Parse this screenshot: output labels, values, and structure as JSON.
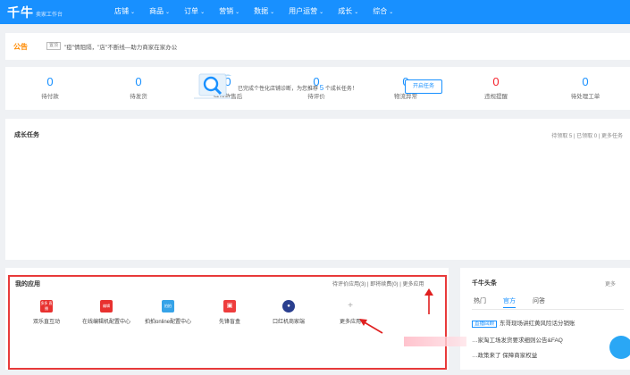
{
  "header": {
    "logo": "千牛",
    "subtitle": "卖家工作台",
    "nav": [
      "店铺",
      "商品",
      "订单",
      "营销",
      "数据",
      "用户运营",
      "成长",
      "综合"
    ]
  },
  "notice": {
    "label": "公告",
    "tag": "置顶",
    "text": "\"疫\"情阻隔，\"店\"不断线—助力商家在家办公"
  },
  "stats": [
    {
      "value": "0",
      "label": "待付款"
    },
    {
      "value": "0",
      "label": "待发货"
    },
    {
      "value": "0",
      "label": "待退款售后"
    },
    {
      "value": "0",
      "label": "待评价"
    },
    {
      "value": "0",
      "label": "物流异常"
    },
    {
      "value": "0",
      "label": "违规提醒"
    },
    {
      "value": "0",
      "label": "待处理工单"
    }
  ],
  "colors": {
    "primary": "#1890ff",
    "alert": "#f5222d",
    "highlight_border": "#e83a3a",
    "notice": "#ff8a00"
  },
  "growth": {
    "title": "成长任务",
    "summary": "待领取 5 | 已领取 0 | 更多任务",
    "message_prefix": "已完成个性化店铺诊断，为您推荐",
    "message_count": "5",
    "message_suffix": "个成长任务！",
    "button": "开启任务"
  },
  "apps": {
    "title": "我的应用",
    "links": "待评价应用(3) | 即将续费(0) | 更多应用",
    "items": [
      {
        "label": "双乐直互动",
        "icon": "red-app-icon",
        "color": "#e8312f",
        "glyph": "多多 直播"
      },
      {
        "label": "在线编辑机配置中心",
        "icon": "red-app-icon",
        "color": "#e8312f",
        "glyph": "编辑"
      },
      {
        "label": "拍拍online配置中心",
        "icon": "blue-app-icon",
        "color": "#36a3e8",
        "glyph": "拍拍"
      },
      {
        "label": "先锋盲盒",
        "icon": "gift-icon",
        "color": "#ee3d3d",
        "glyph": "▣"
      },
      {
        "label": "口红机商家端",
        "icon": "navy-app-icon",
        "color": "#2a3f8f",
        "glyph": "●"
      },
      {
        "label": "更多应用",
        "icon": "plus-icon",
        "color": "",
        "glyph": "+"
      }
    ]
  },
  "news": {
    "title": "千牛头条",
    "more": "更多",
    "tabs": [
      "热门",
      "官方",
      "问答"
    ],
    "items": [
      {
        "tag": "直播回顾",
        "text": "东哥现场讲红黄风险话分销账"
      },
      {
        "tag": "",
        "text": "…家淘工场发货要求细则公告&FAQ"
      },
      {
        "tag": "",
        "text": "…政策来了 保障商家权益"
      }
    ]
  }
}
